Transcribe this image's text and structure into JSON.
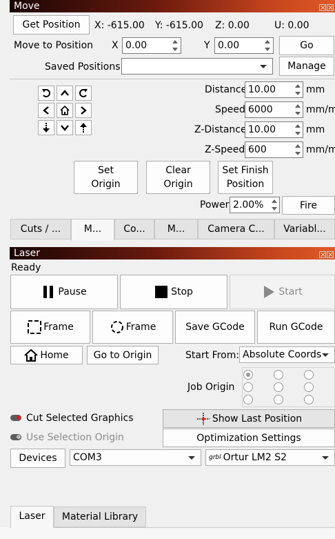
{
  "move_panel": {
    "title": "Move",
    "get_position_label": "Get Position",
    "coords": {
      "x": "X: -615.00",
      "y": "Y: -615.00",
      "z": "Z: 0.00",
      "u": "U: 0.00"
    },
    "move_to_position_label": "Move to Position",
    "x_label": "X",
    "x_value": "0.00",
    "y_label": "Y",
    "y_value": "0.00",
    "go_label": "Go",
    "saved_positions_label": "Saved Positions:",
    "saved_positions_value": "",
    "manage_label": "Manage",
    "distance_label": "Distance",
    "distance_value": "10.00",
    "distance_unit": "mm",
    "speed_label": "Speed",
    "speed_value": "6000",
    "speed_unit": "mm/m",
    "z_distance_label": "Z-Distance",
    "z_distance_value": "10.00",
    "z_distance_unit": "mm",
    "z_speed_label": "Z-Speed",
    "z_speed_value": "600",
    "z_speed_unit": "mm/m",
    "set_origin_label": [
      "Set",
      "Origin"
    ],
    "clear_origin_label": [
      "Clear",
      "Origin"
    ],
    "set_finish_label": [
      "Set Finish",
      "Position"
    ],
    "power_label": "Power",
    "power_value": "2.00%",
    "fire_label": "Fire",
    "tabs": [
      "Cuts / ...",
      "M...",
      "Co...",
      "M...",
      "Camera C...",
      "Variabl..."
    ]
  },
  "laser_panel": {
    "title": "Laser",
    "status": "Ready",
    "pause_label": "Pause",
    "stop_label": "Stop",
    "start_label": "Start",
    "frame1_label": "Frame",
    "frame2_label": "Frame",
    "save_gcode_label": "Save GCode",
    "run_gcode_label": "Run GCode",
    "home_label": "Home",
    "go_to_origin_label": "Go to Origin",
    "start_from_label": "Start From:",
    "start_from_value": "Absolute Coords",
    "job_origin_label": "Job Origin",
    "cut_selected_label": "Cut Selected Graphics",
    "use_selection_origin_label": "Use Selection Origin",
    "show_last_position_label": "Show Last Position",
    "optimization_label": "Optimization Settings",
    "devices_label": "Devices",
    "port_value": "COM3",
    "device_prefix": "grbl",
    "device_value": "Ortur LM2 S2",
    "bottom_tabs": [
      "Laser",
      "Material Library"
    ]
  },
  "colors": {
    "title_dark": "#1a0504",
    "title_light": "#e05a26",
    "crosshair_red": "#e41b1b"
  }
}
